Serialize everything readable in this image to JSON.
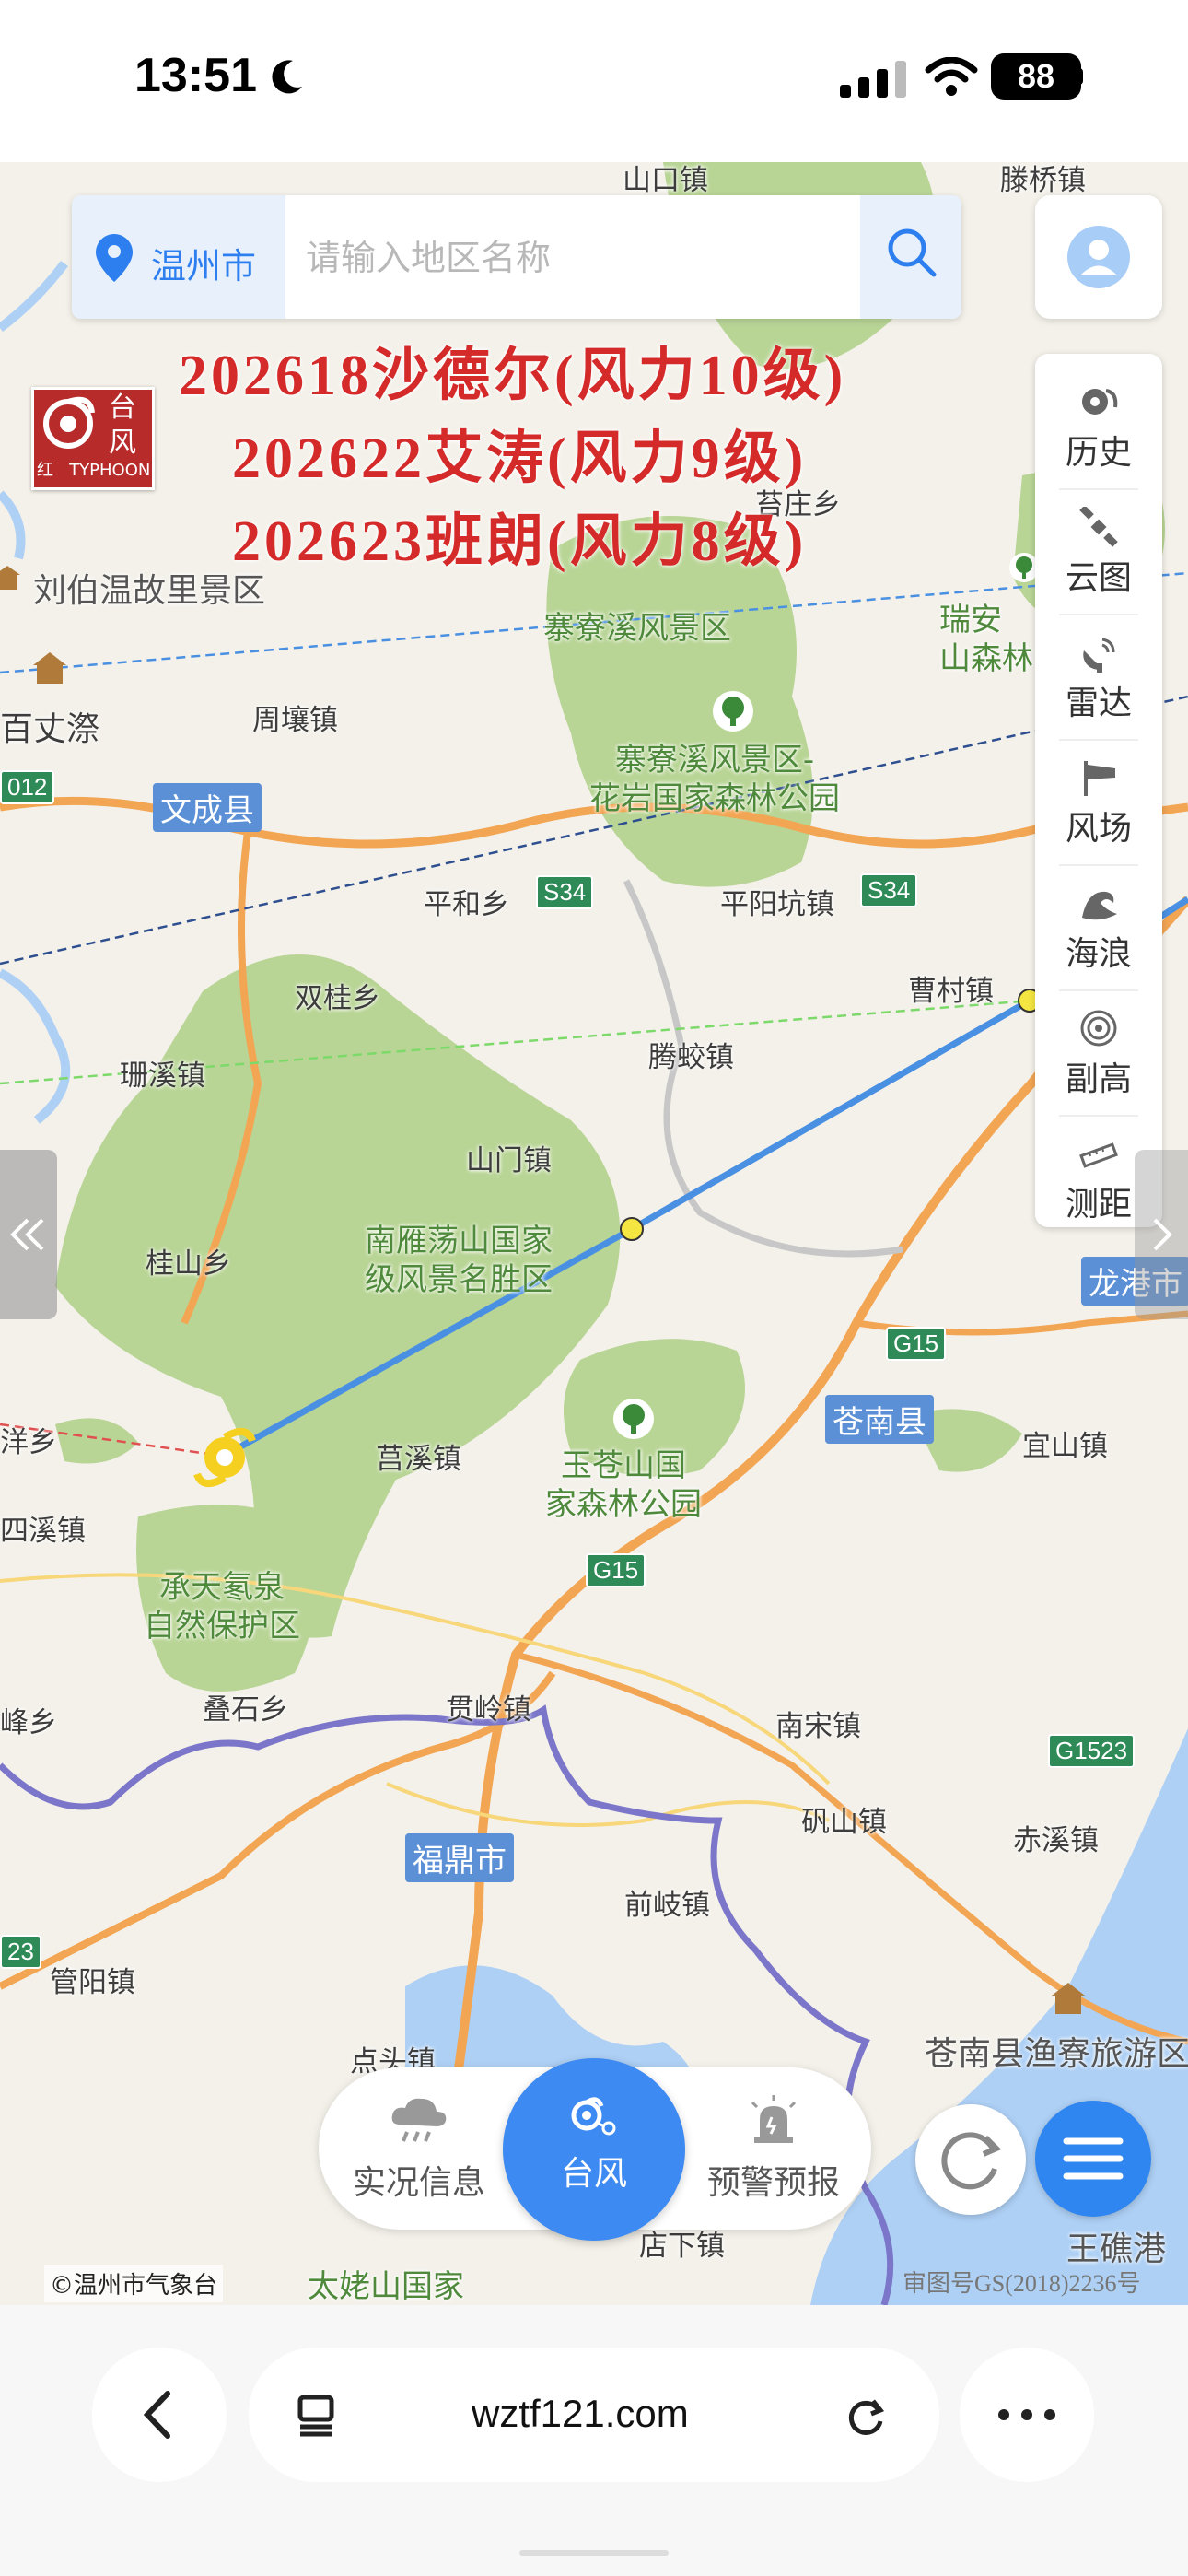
{
  "status_bar": {
    "time": "13:51",
    "battery": "88"
  },
  "search": {
    "city": "温州市",
    "placeholder": "请输入地区名称"
  },
  "typhoon_list": [
    "202618沙德尔(风力10级)",
    "202622艾涛(风力9级)",
    "202623班朗(风力8级)"
  ],
  "signal": {
    "label": "台风",
    "level": "红",
    "sub": "TYPHOON"
  },
  "tools": [
    {
      "label": "历史",
      "icon": "history-icon"
    },
    {
      "label": "云图",
      "icon": "satellite-icon"
    },
    {
      "label": "雷达",
      "icon": "radar-icon"
    },
    {
      "label": "风场",
      "icon": "wind-flag-icon"
    },
    {
      "label": "海浪",
      "icon": "wave-icon"
    },
    {
      "label": "副高",
      "icon": "pressure-icon"
    },
    {
      "label": "测距",
      "icon": "ruler-icon"
    }
  ],
  "map": {
    "places": [
      {
        "name": "山口镇"
      },
      {
        "name": "滕桥镇"
      },
      {
        "name": "刘伯温故里景区"
      },
      {
        "name": "百丈漈"
      },
      {
        "name": "周壤镇"
      },
      {
        "name": "平和乡"
      },
      {
        "name": "平阳坑镇"
      },
      {
        "name": "双桂乡"
      },
      {
        "name": "珊溪镇"
      },
      {
        "name": "腾蛟镇"
      },
      {
        "name": "曹村镇"
      },
      {
        "name": "山门镇"
      },
      {
        "name": "桂山乡"
      },
      {
        "name": "莒溪镇"
      },
      {
        "name": "宜山镇"
      },
      {
        "name": "四溪镇"
      },
      {
        "name": "贯岭镇"
      },
      {
        "name": "南宋镇"
      },
      {
        "name": "矾山镇"
      },
      {
        "name": "赤溪镇"
      },
      {
        "name": "前岐镇"
      },
      {
        "name": "管阳镇"
      },
      {
        "name": "店下镇"
      },
      {
        "name": "王礁港"
      },
      {
        "name": "叠石乡"
      },
      {
        "name": "洋乡"
      },
      {
        "name": "峰乡"
      },
      {
        "name": "苔庄乡"
      },
      {
        "name": "点头镇"
      }
    ],
    "parks": [
      {
        "name": "寨寮溪风景区"
      },
      {
        "name": "寨寮溪风景区-\n花岩国家森林公园"
      },
      {
        "name": "南雁荡山国家\n级风景名胜区"
      },
      {
        "name": "玉苍山国\n家森林公园"
      },
      {
        "name": "承天氡泉\n自然保护区"
      },
      {
        "name": "瑞安\n山森林"
      },
      {
        "name": "太姥山国家"
      },
      {
        "name": "苍南县渔寮旅游区"
      }
    ],
    "counties": [
      {
        "name": "文成县"
      },
      {
        "name": "苍南县"
      },
      {
        "name": "福鼎市"
      },
      {
        "name": "龙港市"
      }
    ],
    "highways": [
      "S34",
      "S34",
      "G15",
      "G15",
      "G1523",
      "012",
      "23"
    ]
  },
  "nav": {
    "weather": "实况信息",
    "typhoon": "台风",
    "warning": "预警预报"
  },
  "copyright": "©温州市气象台",
  "map_number": "审图号GS(2018)2236号",
  "browser": {
    "url": "wztf121.com"
  },
  "colors": {
    "accent": "#3d8af2",
    "track": "#4a90e2",
    "typhoon_text": "#d42a2a",
    "park": "#b9d596"
  }
}
